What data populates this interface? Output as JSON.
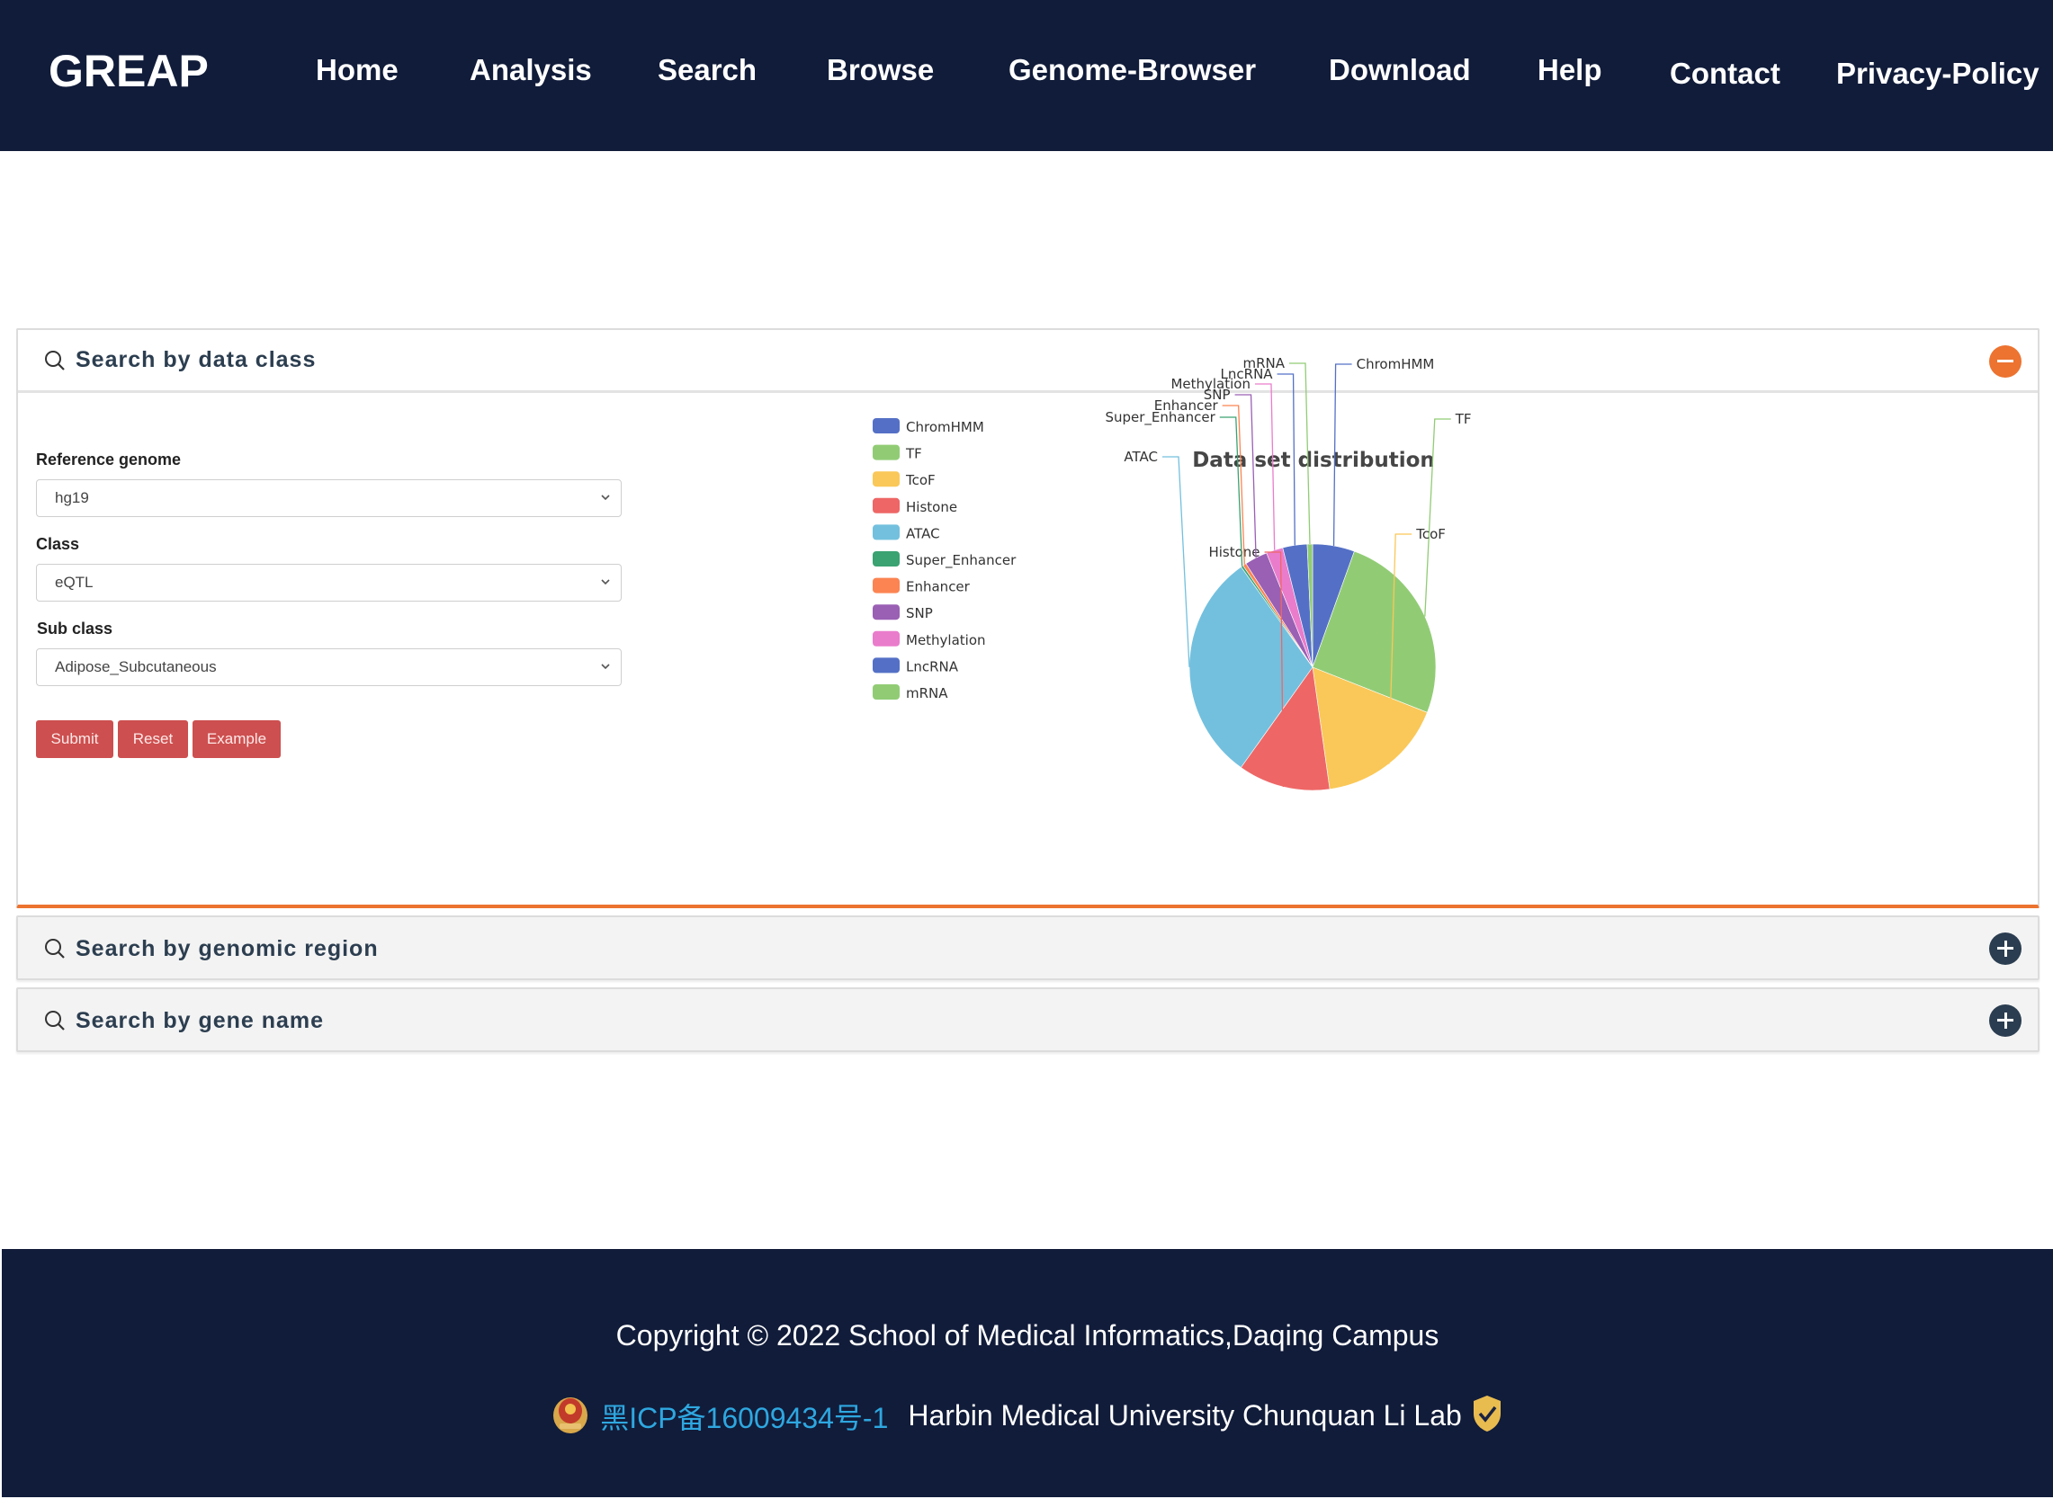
{
  "header": {
    "brand": "GREAP",
    "nav": [
      {
        "label": "Home"
      },
      {
        "label": "Analysis"
      },
      {
        "label": "Search"
      },
      {
        "label": "Browse"
      },
      {
        "label": "Genome-Browser"
      },
      {
        "label": "Download"
      },
      {
        "label": "Help"
      },
      {
        "label": "Contact"
      },
      {
        "label": "Privacy-Policy"
      }
    ]
  },
  "panels": [
    {
      "title": "Search by data class",
      "icon": "search-icon",
      "toggle": "minus",
      "expanded": true
    },
    {
      "title": "Search by genomic region",
      "icon": "search-icon",
      "toggle": "plus",
      "expanded": false
    },
    {
      "title": "Search by gene name",
      "icon": "search-icon",
      "toggle": "plus",
      "expanded": false
    }
  ],
  "form": {
    "reference_genome": {
      "label": "Reference genome",
      "value": "hg19"
    },
    "class": {
      "label": "Class",
      "value": "eQTL"
    },
    "sub_class": {
      "label": "Sub class",
      "value": "Adipose_Subcutaneous"
    },
    "buttons": {
      "submit": "Submit",
      "reset": "Reset",
      "example": "Example"
    }
  },
  "colors": {
    "header_bg": "#111c3a",
    "accent_orange": "#ec7330",
    "button_red": "#cd4f4f",
    "toggle_dark": "#2b3d50",
    "icp_link": "#2ea7e0"
  },
  "chart_data": {
    "type": "pie",
    "title": "Data set distribution",
    "legend_position": "left",
    "unit": "percent (estimated from slice angles)",
    "categories": [
      "ChromHMM",
      "TF",
      "TcoF",
      "Histone",
      "ATAC",
      "Super_Enhancer",
      "Enhancer",
      "SNP",
      "Methylation",
      "LncRNA",
      "mRNA"
    ],
    "values": [
      5.5,
      25.5,
      16.8,
      12.1,
      30.3,
      0.3,
      0.45,
      3.0,
      2.2,
      3.2,
      0.7
    ],
    "colors": [
      "#5470c6",
      "#91cc75",
      "#fac858",
      "#ee6666",
      "#73c0de",
      "#3ba272",
      "#fc8452",
      "#9a60b4",
      "#ea7ccc",
      "#5470c6",
      "#91cc75"
    ]
  },
  "footer": {
    "copyright": "Copyright © 2022 School of Medical Informatics,Daqing Campus",
    "icp": "黑ICP备16009434号-1",
    "lab": "Harbin Medical University Chunquan Li Lab"
  }
}
